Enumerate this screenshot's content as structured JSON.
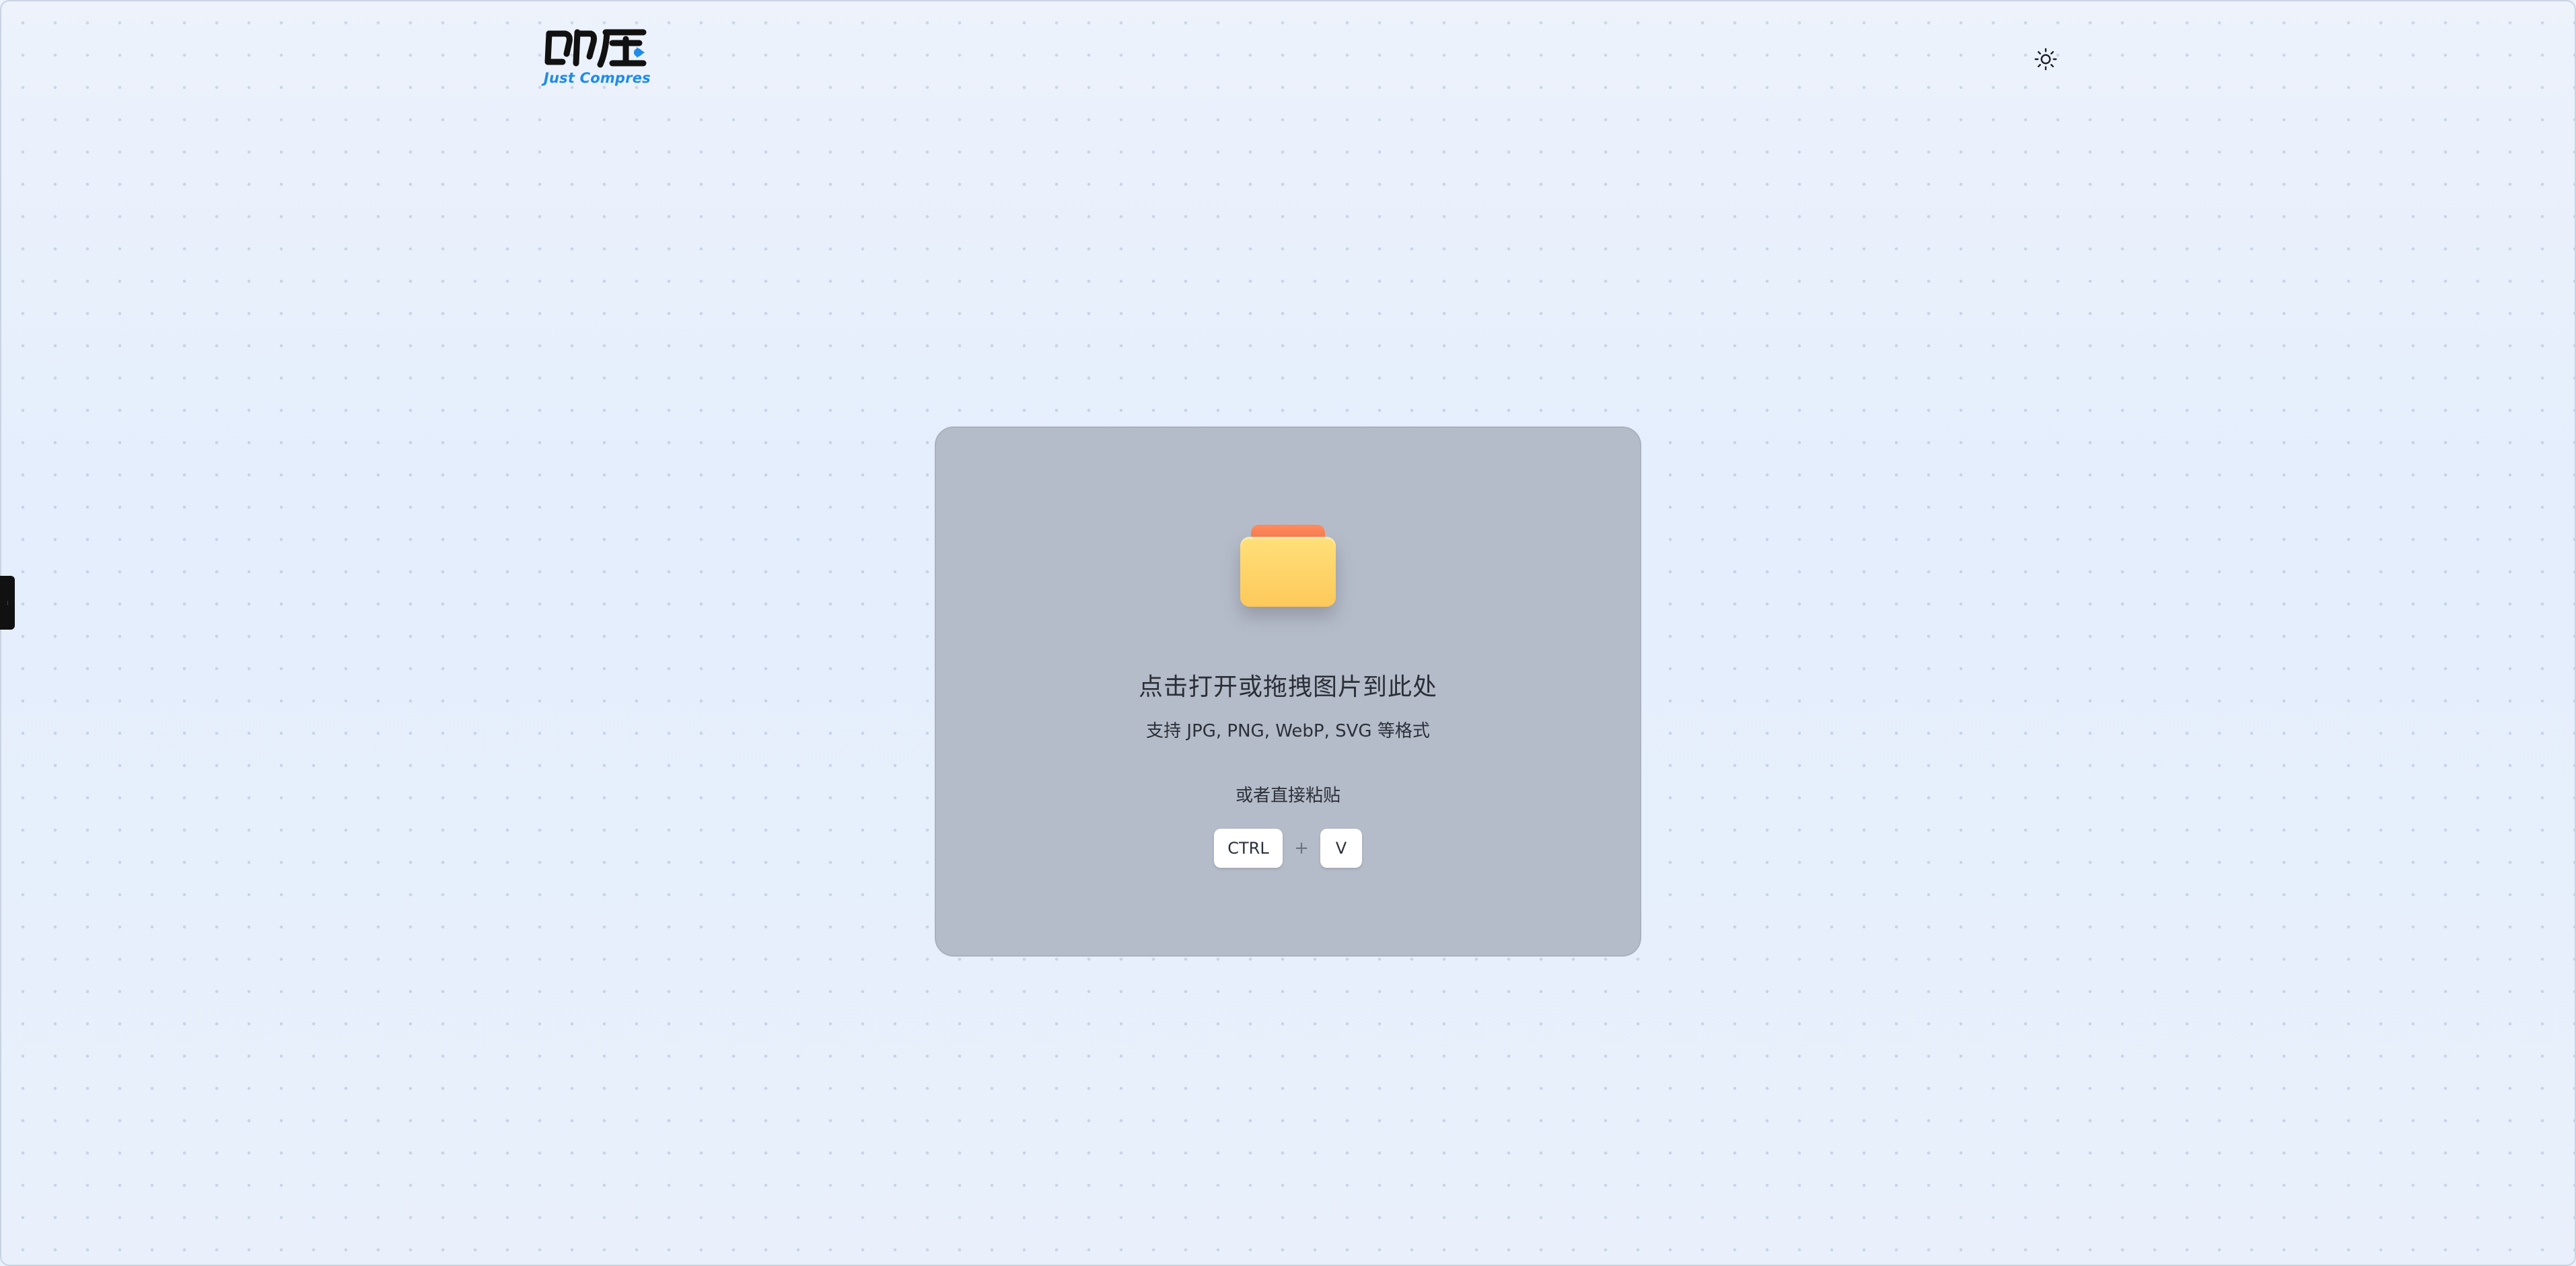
{
  "header": {
    "logo_text": "即压",
    "logo_caption": "Just Compres",
    "theme_toggle_icon": "sun-icon"
  },
  "dropzone": {
    "icon": "folder-icon",
    "title": "点击打开或拖拽图片到此处",
    "subtitle": "支持 JPG, PNG, WebP, SVG 等格式",
    "paste_hint": "或者直接粘贴",
    "shortcut": {
      "key1": "CTRL",
      "separator": "+",
      "key2": "V"
    }
  },
  "side_tab": {
    "label": "···"
  },
  "colors": {
    "accent": "#1f8ce8",
    "folder_tab": "#f57a4c",
    "folder_body": "#fdc95a",
    "dropzone_bg": "#b5bcc9"
  }
}
